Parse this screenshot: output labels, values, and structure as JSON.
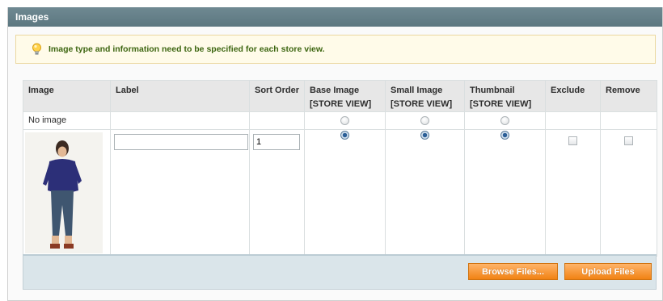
{
  "panel": {
    "title": "Images"
  },
  "notice": {
    "text": "Image type and information need to be specified for each store view."
  },
  "table": {
    "headers": {
      "image": "Image",
      "label": "Label",
      "sort_order": "Sort Order",
      "base_image": "Base Image",
      "base_image_scope": "[STORE VIEW]",
      "small_image": "Small Image",
      "small_image_scope": "[STORE VIEW]",
      "thumbnail": "Thumbnail",
      "thumbnail_scope": "[STORE VIEW]",
      "exclude": "Exclude",
      "remove": "Remove"
    },
    "no_image_row": {
      "label": "No image",
      "base_image_selected": false,
      "small_image_selected": false,
      "thumbnail_selected": false
    },
    "image_row": {
      "label_value": "",
      "sort_order_value": "1",
      "base_image_selected": true,
      "small_image_selected": true,
      "thumbnail_selected": true,
      "exclude_checked": false,
      "remove_checked": false
    }
  },
  "buttons": {
    "browse": "Browse Files...",
    "upload": "Upload Files"
  },
  "colors": {
    "header_bg": "#627c85",
    "notice_bg": "#fffbe9",
    "notice_text": "#3d6611",
    "footer_bg": "#dae5ea",
    "button_orange": "#f18214"
  },
  "icons": {
    "notice": "lightbulb-icon"
  }
}
